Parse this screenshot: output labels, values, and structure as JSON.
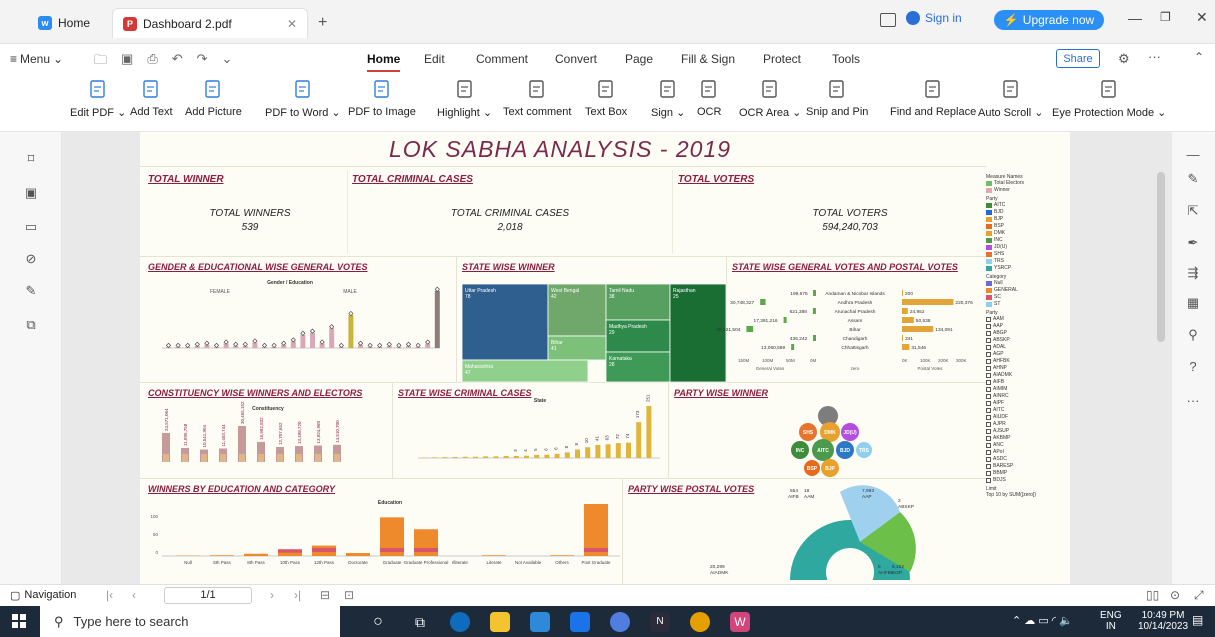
{
  "tabs": [
    {
      "label": "Home",
      "icon": "wps-icon"
    },
    {
      "label": "Dashboard 2.pdf",
      "icon": "pdf-icon"
    }
  ],
  "window": {
    "sign_in": "Sign in",
    "upgrade": "Upgrade now"
  },
  "menu": {
    "menu_label": "Menu",
    "items": [
      "Home",
      "Edit",
      "Comment",
      "Convert",
      "Page",
      "Fill & Sign",
      "Protect",
      "Tools"
    ],
    "share": "Share"
  },
  "ribbon": [
    "Edit PDF",
    "Add Text",
    "Add Picture",
    "PDF to Word",
    "PDF to Image",
    "Highlight",
    "Text comment",
    "Text Box",
    "Sign",
    "OCR",
    "OCR Area",
    "Snip and Pin",
    "Find and Replace",
    "Auto Scroll",
    "Eye Protection Mode"
  ],
  "dashboard": {
    "title": "LOK SABHA ANALYSIS - 2019",
    "kpis": [
      {
        "header": "TOTAL WINNER",
        "label": "TOTAL WINNERS",
        "value": "539"
      },
      {
        "header": "TOTAL CRIMINAL CASES",
        "label": "TOTAL CRIMINAL CASES",
        "value": "2,018"
      },
      {
        "header": "TOTAL VOTERS",
        "label": "TOTAL VOTERS",
        "value": "594,240,703"
      }
    ],
    "sections": {
      "gender": "GENDER & EDUCATIONAL WISE GENERAL VOTES",
      "gender_sub": "Gender / Education",
      "female": "FEMALE",
      "male": "MALE",
      "state_winner": "STATE WISE WINNER",
      "state_votes": "STATE WISE GENERAL VOTES AND POSTAL VOTES",
      "constituency": "CONSTITUENCY WISE WINNERS AND ELECTORS",
      "constituency_sub": "Constituency",
      "criminal": "STATE WISE CRIMINAL CASES",
      "criminal_sub": "State",
      "party_winner": "PARTY WISE WINNER",
      "education": "WINNERS BY EDUCATION AND CATEGORY",
      "education_sub": "Education",
      "postal": "PARTY WISE POSTAL VOTES"
    },
    "treemap": [
      {
        "state": "Uttar Pradesh",
        "value": "78"
      },
      {
        "state": "West Bengal",
        "value": "42"
      },
      {
        "state": "Tamil Nadu",
        "value": "38"
      },
      {
        "state": "Madhya Pradesh",
        "value": "29"
      },
      {
        "state": "Bihar",
        "value": "41"
      },
      {
        "state": "Maharashtra",
        "value": "47"
      },
      {
        "state": "Karnataka",
        "value": "28"
      },
      {
        "state": "Rajasthan",
        "value": "25"
      }
    ],
    "state_votes_rows": [
      {
        "gen": "199,675",
        "state": "Andaman & Nicobar Islands",
        "postal": "200"
      },
      {
        "gen": "30,748,327",
        "state": "Andhra Pradesh",
        "postal": "220,376"
      },
      {
        "gen": "621,388",
        "state": "Arunachal Pradesh",
        "postal": "24,952"
      },
      {
        "gen": "17,391,216",
        "state": "Assam",
        "postal": "50,538"
      },
      {
        "gen": "38,621,504",
        "state": "Bihar",
        "postal": "134,091"
      },
      {
        "gen": "436,242",
        "state": "Chandigarh",
        "postal": "341"
      },
      {
        "gen": "13,060,689",
        "state": "Chhattisgarh",
        "postal": "31,546"
      }
    ],
    "state_votes_axes": {
      "left": [
        "150M",
        "100M",
        "50M",
        "0M"
      ],
      "left_label": "General Votes",
      "mid_label": "zero",
      "right": [
        "0K",
        "100K",
        "200K",
        "300K"
      ],
      "right_label": "Postal Votes"
    },
    "edu_categories": [
      "Null",
      "5th Pass",
      "8th Pass",
      "10th Pass",
      "12th Pass",
      "Doctorate",
      "Graduate",
      "Graduate Professional",
      "Illiterate",
      "Literate",
      "Not Available",
      "Others",
      "Post Graduate"
    ],
    "edu_values": [
      1,
      2,
      6,
      18,
      28,
      8,
      104,
      72,
      0,
      2,
      0,
      2,
      140
    ],
    "criminal_values": [
      2,
      3,
      4,
      5,
      6,
      6,
      8,
      8,
      10,
      10,
      11,
      15,
      16,
      20,
      27,
      41,
      52,
      63,
      66,
      72,
      74,
      173,
      251
    ],
    "criminal_labels": [
      "3",
      "4",
      "5",
      "6",
      "6",
      "8",
      "8",
      "10",
      "41",
      "63",
      "72",
      "74",
      "173",
      "251"
    ],
    "constituency_labels": [
      "24,571,064",
      "11,895,758",
      "10,541,904",
      "11,403,744",
      "30,455,152",
      "16,992,832",
      "12,707,652",
      "13,498,720",
      "13,924,960",
      "14,510,700"
    ],
    "bubbles": [
      "SHS",
      "DMK",
      "JD(U)",
      "INC",
      "AITC",
      "BJD",
      "TRS",
      "BSP",
      "BJP"
    ],
    "postal_labels": [
      "554",
      "18",
      "AIFB",
      "AAM",
      "7,993",
      "AAP",
      "2",
      "ABSKP",
      "20,299",
      "AIADMK",
      "5",
      "6,152",
      "AHFBK",
      "AGP"
    ],
    "legend": {
      "measure_title": "Measure Names",
      "measures": [
        "Total Electors",
        "Winner"
      ],
      "party_title": "Party",
      "parties": [
        "AITC",
        "BJD",
        "BJP",
        "BSP",
        "DMK",
        "INC",
        "JD(U)",
        "SHS",
        "TRS",
        "YSRCP"
      ],
      "category_title": "Category",
      "categories": [
        "Null",
        "GENERAL",
        "SC",
        "ST"
      ],
      "party_filter": [
        "AAM",
        "AAP",
        "ABGP",
        "ABSKP",
        "ADAL",
        "AGP",
        "AHFBK",
        "AHNP",
        "AIADMK",
        "AIFB",
        "AIMIM",
        "AINRC",
        "AIPF",
        "AITC",
        "AIUDF",
        "AJPR",
        "AJSUP",
        "AKBMP",
        "ANC",
        "APoI",
        "ASDC",
        "BARESP",
        "BBMP",
        "BDJS"
      ],
      "limit": "Limit",
      "limit_value": "Top 10 by SUM([zero])"
    }
  },
  "status": {
    "navigation": "Navigation",
    "page": "1/1"
  },
  "taskbar": {
    "search": "Type here to search",
    "lang": "ENG",
    "region": "IN",
    "time": "10:49 PM",
    "date": "10/14/2023"
  }
}
